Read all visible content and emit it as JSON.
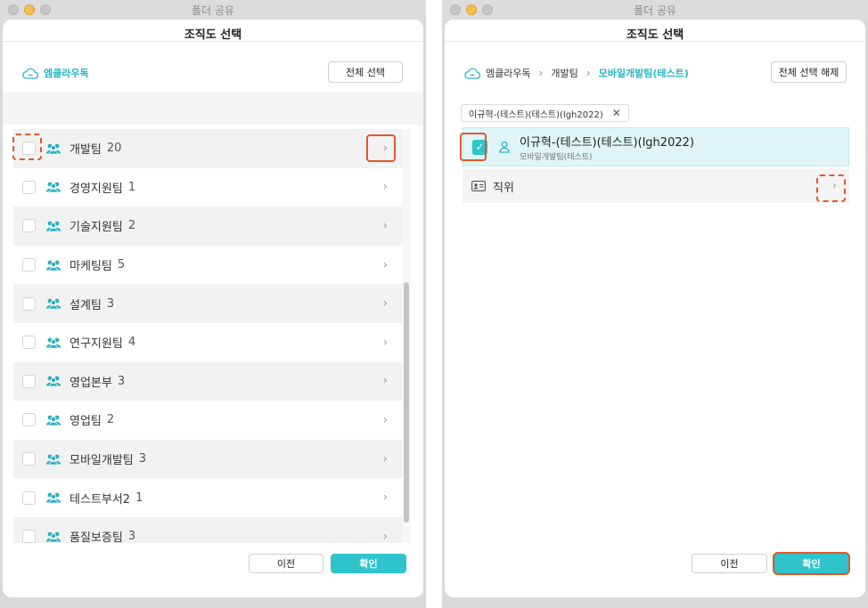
{
  "left": {
    "window_title": "폴더 공유",
    "sheet_title": "조직도 선택",
    "breadcrumb": [
      {
        "label": "엠클라우독"
      }
    ],
    "select_all_label": "전체 선택",
    "teams": [
      {
        "label": "개발팀",
        "count": "20"
      },
      {
        "label": "경영지원팀",
        "count": "1"
      },
      {
        "label": "기술지원팀",
        "count": "2"
      },
      {
        "label": "마케팅팀",
        "count": "5"
      },
      {
        "label": "설계팀",
        "count": "3"
      },
      {
        "label": "연구지원팀",
        "count": "4"
      },
      {
        "label": "영업본부",
        "count": "3"
      },
      {
        "label": "영업팀",
        "count": "2"
      },
      {
        "label": "모바일개발팀",
        "count": "3"
      },
      {
        "label": "테스트부서2",
        "count": "1"
      },
      {
        "label": "품질보증팀",
        "count": "3"
      }
    ],
    "prev_label": "이전",
    "confirm_label": "확인"
  },
  "right": {
    "window_title": "폴더 공유",
    "sheet_title": "조직도 선택",
    "breadcrumb": [
      {
        "label": "엠클라우독"
      },
      {
        "label": "개발팀"
      },
      {
        "label": "모바일개발팀(테스트)"
      }
    ],
    "deselect_all_label": "전체 선택 해제",
    "chip_label": "이규혁-(테스트)(테스트)(lgh2022)",
    "selected_person": {
      "name": "이규혁-(테스트)(테스트)(lgh2022)",
      "dept": "모바일개발팀(테스트)",
      "checked": true
    },
    "position_label": "직위",
    "prev_label": "이전",
    "confirm_label": "확인"
  },
  "colors": {
    "accent": "#2fc4cb",
    "highlight": "#e2572a",
    "selected_row": "#dff5f8"
  },
  "icons": {
    "breadcrumb_root": "cloud-icon",
    "team": "team-icon",
    "person": "person-icon",
    "position": "id-card-icon",
    "next": "chevron-right-icon",
    "chip_remove": "close-icon"
  }
}
